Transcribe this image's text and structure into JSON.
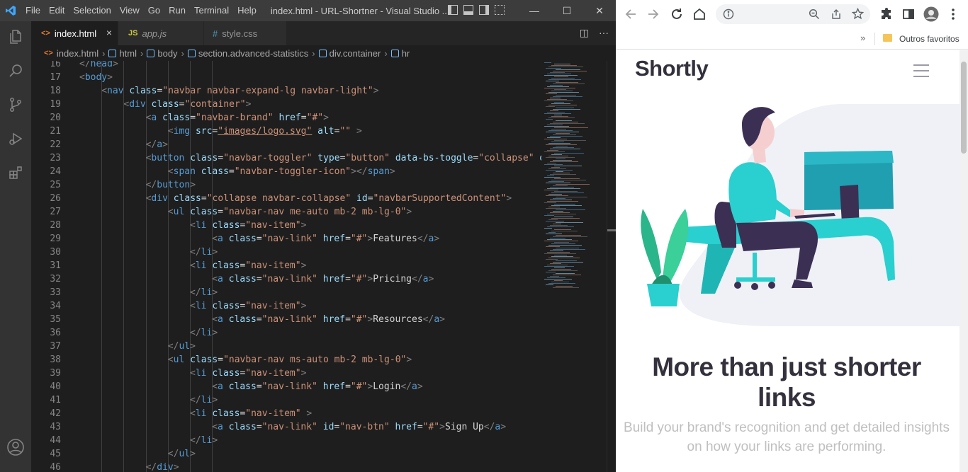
{
  "vscode": {
    "menu": [
      "File",
      "Edit",
      "Selection",
      "View",
      "Go",
      "Run",
      "Terminal",
      "Help"
    ],
    "window_title": "index.html - URL-Shortner - Visual Studio ...",
    "tabs": [
      {
        "icon": "<>",
        "label": "index.html",
        "close": "×"
      },
      {
        "icon": "JS",
        "label": "app.js"
      },
      {
        "icon": "#",
        "label": "style.css"
      }
    ],
    "breadcrumb": [
      "index.html",
      "html",
      "body",
      "section.advanced-statistics",
      "div.container",
      "hr"
    ],
    "accent": "#007acc"
  },
  "code_lines": [
    {
      "n": "16",
      "indent": 0,
      "t": [
        [
          "ang",
          "</"
        ],
        [
          "tag",
          "head"
        ],
        [
          "ang",
          ">"
        ]
      ]
    },
    {
      "n": "17",
      "indent": 0,
      "t": [
        [
          "ang",
          "<"
        ],
        [
          "tag",
          "body"
        ],
        [
          "ang",
          ">"
        ]
      ]
    },
    {
      "n": "18",
      "indent": 1,
      "t": [
        [
          "ang",
          "<"
        ],
        [
          "tag",
          "nav"
        ],
        [
          "txt",
          " "
        ],
        [
          "attr",
          "class"
        ],
        [
          "txt",
          "="
        ],
        [
          "str",
          "\"navbar navbar-expand-lg navbar-light\""
        ],
        [
          "ang",
          ">"
        ]
      ]
    },
    {
      "n": "19",
      "indent": 2,
      "t": [
        [
          "ang",
          "<"
        ],
        [
          "tag",
          "div"
        ],
        [
          "txt",
          " "
        ],
        [
          "attr",
          "class"
        ],
        [
          "txt",
          "="
        ],
        [
          "str",
          "\"container\""
        ],
        [
          "ang",
          ">"
        ]
      ]
    },
    {
      "n": "20",
      "indent": 3,
      "t": [
        [
          "ang",
          "<"
        ],
        [
          "tag",
          "a"
        ],
        [
          "txt",
          " "
        ],
        [
          "attr",
          "class"
        ],
        [
          "txt",
          "="
        ],
        [
          "str",
          "\"navbar-brand\""
        ],
        [
          "txt",
          " "
        ],
        [
          "attr",
          "href"
        ],
        [
          "txt",
          "="
        ],
        [
          "str",
          "\"#\""
        ],
        [
          "ang",
          ">"
        ]
      ]
    },
    {
      "n": "21",
      "indent": 4,
      "t": [
        [
          "ang",
          "<"
        ],
        [
          "tag",
          "img"
        ],
        [
          "txt",
          " "
        ],
        [
          "attr",
          "src"
        ],
        [
          "txt",
          "="
        ],
        [
          "str",
          "\"images/logo.svg\""
        ],
        [
          "txt",
          " "
        ],
        [
          "attr",
          "alt"
        ],
        [
          "txt",
          "="
        ],
        [
          "str",
          "\"\""
        ],
        [
          "txt",
          " "
        ],
        [
          "ang",
          ">"
        ]
      ]
    },
    {
      "n": "22",
      "indent": 3,
      "t": [
        [
          "ang",
          "</"
        ],
        [
          "tag",
          "a"
        ],
        [
          "ang",
          ">"
        ]
      ]
    },
    {
      "n": "23",
      "indent": 3,
      "t": [
        [
          "ang",
          "<"
        ],
        [
          "tag",
          "button"
        ],
        [
          "txt",
          " "
        ],
        [
          "attr",
          "class"
        ],
        [
          "txt",
          "="
        ],
        [
          "str",
          "\"navbar-toggler\""
        ],
        [
          "txt",
          " "
        ],
        [
          "attr",
          "type"
        ],
        [
          "txt",
          "="
        ],
        [
          "str",
          "\"button\""
        ],
        [
          "txt",
          " "
        ],
        [
          "attr",
          "data-bs-toggle"
        ],
        [
          "txt",
          "="
        ],
        [
          "str",
          "\"collapse\""
        ],
        [
          "txt",
          " "
        ],
        [
          "attr",
          "da"
        ]
      ]
    },
    {
      "n": "24",
      "indent": 4,
      "t": [
        [
          "ang",
          "<"
        ],
        [
          "tag",
          "span"
        ],
        [
          "txt",
          " "
        ],
        [
          "attr",
          "class"
        ],
        [
          "txt",
          "="
        ],
        [
          "str",
          "\"navbar-toggler-icon\""
        ],
        [
          "ang",
          ">"
        ],
        [
          "ang",
          "</"
        ],
        [
          "tag",
          "span"
        ],
        [
          "ang",
          ">"
        ]
      ]
    },
    {
      "n": "25",
      "indent": 3,
      "t": [
        [
          "ang",
          "</"
        ],
        [
          "tag",
          "button"
        ],
        [
          "ang",
          ">"
        ]
      ]
    },
    {
      "n": "26",
      "indent": 3,
      "t": [
        [
          "ang",
          "<"
        ],
        [
          "tag",
          "div"
        ],
        [
          "txt",
          " "
        ],
        [
          "attr",
          "class"
        ],
        [
          "txt",
          "="
        ],
        [
          "str",
          "\"collapse navbar-collapse\""
        ],
        [
          "txt",
          " "
        ],
        [
          "attr",
          "id"
        ],
        [
          "txt",
          "="
        ],
        [
          "str",
          "\"navbarSupportedContent\""
        ],
        [
          "ang",
          ">"
        ]
      ]
    },
    {
      "n": "27",
      "indent": 4,
      "t": [
        [
          "ang",
          "<"
        ],
        [
          "tag",
          "ul"
        ],
        [
          "txt",
          " "
        ],
        [
          "attr",
          "class"
        ],
        [
          "txt",
          "="
        ],
        [
          "str",
          "\"navbar-nav me-auto mb-2 mb-lg-0\""
        ],
        [
          "ang",
          ">"
        ]
      ]
    },
    {
      "n": "28",
      "indent": 5,
      "t": [
        [
          "ang",
          "<"
        ],
        [
          "tag",
          "li"
        ],
        [
          "txt",
          " "
        ],
        [
          "attr",
          "class"
        ],
        [
          "txt",
          "="
        ],
        [
          "str",
          "\"nav-item\""
        ],
        [
          "ang",
          ">"
        ]
      ]
    },
    {
      "n": "29",
      "indent": 6,
      "t": [
        [
          "ang",
          "<"
        ],
        [
          "tag",
          "a"
        ],
        [
          "txt",
          " "
        ],
        [
          "attr",
          "class"
        ],
        [
          "txt",
          "="
        ],
        [
          "str",
          "\"nav-link\""
        ],
        [
          "txt",
          " "
        ],
        [
          "attr",
          "href"
        ],
        [
          "txt",
          "="
        ],
        [
          "str",
          "\"#\""
        ],
        [
          "ang",
          ">"
        ],
        [
          "txt",
          "Features"
        ],
        [
          "ang",
          "</"
        ],
        [
          "tag",
          "a"
        ],
        [
          "ang",
          ">"
        ]
      ]
    },
    {
      "n": "30",
      "indent": 5,
      "t": [
        [
          "ang",
          "</"
        ],
        [
          "tag",
          "li"
        ],
        [
          "ang",
          ">"
        ]
      ]
    },
    {
      "n": "31",
      "indent": 5,
      "t": [
        [
          "ang",
          "<"
        ],
        [
          "tag",
          "li"
        ],
        [
          "txt",
          " "
        ],
        [
          "attr",
          "class"
        ],
        [
          "txt",
          "="
        ],
        [
          "str",
          "\"nav-item\""
        ],
        [
          "ang",
          ">"
        ]
      ]
    },
    {
      "n": "32",
      "indent": 6,
      "t": [
        [
          "ang",
          "<"
        ],
        [
          "tag",
          "a"
        ],
        [
          "txt",
          " "
        ],
        [
          "attr",
          "class"
        ],
        [
          "txt",
          "="
        ],
        [
          "str",
          "\"nav-link\""
        ],
        [
          "txt",
          " "
        ],
        [
          "attr",
          "href"
        ],
        [
          "txt",
          "="
        ],
        [
          "str",
          "\"#\""
        ],
        [
          "ang",
          ">"
        ],
        [
          "txt",
          "Pricing"
        ],
        [
          "ang",
          "</"
        ],
        [
          "tag",
          "a"
        ],
        [
          "ang",
          ">"
        ]
      ]
    },
    {
      "n": "33",
      "indent": 5,
      "t": [
        [
          "ang",
          "</"
        ],
        [
          "tag",
          "li"
        ],
        [
          "ang",
          ">"
        ]
      ]
    },
    {
      "n": "34",
      "indent": 5,
      "t": [
        [
          "ang",
          "<"
        ],
        [
          "tag",
          "li"
        ],
        [
          "txt",
          " "
        ],
        [
          "attr",
          "class"
        ],
        [
          "txt",
          "="
        ],
        [
          "str",
          "\"nav-item\""
        ],
        [
          "ang",
          ">"
        ]
      ]
    },
    {
      "n": "35",
      "indent": 6,
      "t": [
        [
          "ang",
          "<"
        ],
        [
          "tag",
          "a"
        ],
        [
          "txt",
          " "
        ],
        [
          "attr",
          "class"
        ],
        [
          "txt",
          "="
        ],
        [
          "str",
          "\"nav-link\""
        ],
        [
          "txt",
          " "
        ],
        [
          "attr",
          "href"
        ],
        [
          "txt",
          "="
        ],
        [
          "str",
          "\"#\""
        ],
        [
          "ang",
          ">"
        ],
        [
          "txt",
          "Resources"
        ],
        [
          "ang",
          "</"
        ],
        [
          "tag",
          "a"
        ],
        [
          "ang",
          ">"
        ]
      ]
    },
    {
      "n": "36",
      "indent": 5,
      "t": [
        [
          "ang",
          "</"
        ],
        [
          "tag",
          "li"
        ],
        [
          "ang",
          ">"
        ]
      ]
    },
    {
      "n": "37",
      "indent": 4,
      "t": [
        [
          "ang",
          "</"
        ],
        [
          "tag",
          "ul"
        ],
        [
          "ang",
          ">"
        ]
      ]
    },
    {
      "n": "38",
      "indent": 4,
      "t": [
        [
          "ang",
          "<"
        ],
        [
          "tag",
          "ul"
        ],
        [
          "txt",
          " "
        ],
        [
          "attr",
          "class"
        ],
        [
          "txt",
          "="
        ],
        [
          "str",
          "\"navbar-nav ms-auto mb-2 mb-lg-0\""
        ],
        [
          "ang",
          ">"
        ]
      ]
    },
    {
      "n": "39",
      "indent": 5,
      "t": [
        [
          "ang",
          "<"
        ],
        [
          "tag",
          "li"
        ],
        [
          "txt",
          " "
        ],
        [
          "attr",
          "class"
        ],
        [
          "txt",
          "="
        ],
        [
          "str",
          "\"nav-item\""
        ],
        [
          "ang",
          ">"
        ]
      ]
    },
    {
      "n": "40",
      "indent": 6,
      "t": [
        [
          "ang",
          "<"
        ],
        [
          "tag",
          "a"
        ],
        [
          "txt",
          " "
        ],
        [
          "attr",
          "class"
        ],
        [
          "txt",
          "="
        ],
        [
          "str",
          "\"nav-link\""
        ],
        [
          "txt",
          " "
        ],
        [
          "attr",
          "href"
        ],
        [
          "txt",
          "="
        ],
        [
          "str",
          "\"#\""
        ],
        [
          "ang",
          ">"
        ],
        [
          "txt",
          "Login"
        ],
        [
          "ang",
          "</"
        ],
        [
          "tag",
          "a"
        ],
        [
          "ang",
          ">"
        ]
      ]
    },
    {
      "n": "41",
      "indent": 5,
      "t": [
        [
          "ang",
          "</"
        ],
        [
          "tag",
          "li"
        ],
        [
          "ang",
          ">"
        ]
      ]
    },
    {
      "n": "42",
      "indent": 5,
      "t": [
        [
          "ang",
          "<"
        ],
        [
          "tag",
          "li"
        ],
        [
          "txt",
          " "
        ],
        [
          "attr",
          "class"
        ],
        [
          "txt",
          "="
        ],
        [
          "str",
          "\"nav-item\""
        ],
        [
          "txt",
          " "
        ],
        [
          "ang",
          ">"
        ]
      ]
    },
    {
      "n": "43",
      "indent": 6,
      "t": [
        [
          "ang",
          "<"
        ],
        [
          "tag",
          "a"
        ],
        [
          "txt",
          " "
        ],
        [
          "attr",
          "class"
        ],
        [
          "txt",
          "="
        ],
        [
          "str",
          "\"nav-link\""
        ],
        [
          "txt",
          " "
        ],
        [
          "attr",
          "id"
        ],
        [
          "txt",
          "="
        ],
        [
          "str",
          "\"nav-btn\""
        ],
        [
          "txt",
          " "
        ],
        [
          "attr",
          "href"
        ],
        [
          "txt",
          "="
        ],
        [
          "str",
          "\"#\""
        ],
        [
          "ang",
          ">"
        ],
        [
          "txt",
          "Sign Up"
        ],
        [
          "ang",
          "</"
        ],
        [
          "tag",
          "a"
        ],
        [
          "ang",
          ">"
        ]
      ]
    },
    {
      "n": "44",
      "indent": 5,
      "t": [
        [
          "ang",
          "</"
        ],
        [
          "tag",
          "li"
        ],
        [
          "ang",
          ">"
        ]
      ]
    },
    {
      "n": "45",
      "indent": 4,
      "t": [
        [
          "ang",
          "</"
        ],
        [
          "tag",
          "ul"
        ],
        [
          "ang",
          ">"
        ]
      ]
    },
    {
      "n": "46",
      "indent": 3,
      "t": [
        [
          "ang",
          "</"
        ],
        [
          "tag",
          "div"
        ],
        [
          "ang",
          ">"
        ]
      ]
    }
  ],
  "browser": {
    "bookmarks_overflow": "»",
    "bookmark_folder": "Outros favoritos",
    "page": {
      "brand": "Shortly",
      "headline": "More than just shorter links",
      "subtext": "Build your brand's recognition and get detailed insights on how your links are performing.",
      "colors": {
        "cyan": "#2acfcf",
        "dark_violet": "#3b3054",
        "text": "#34313d",
        "gray": "#bfbfbf"
      }
    }
  }
}
